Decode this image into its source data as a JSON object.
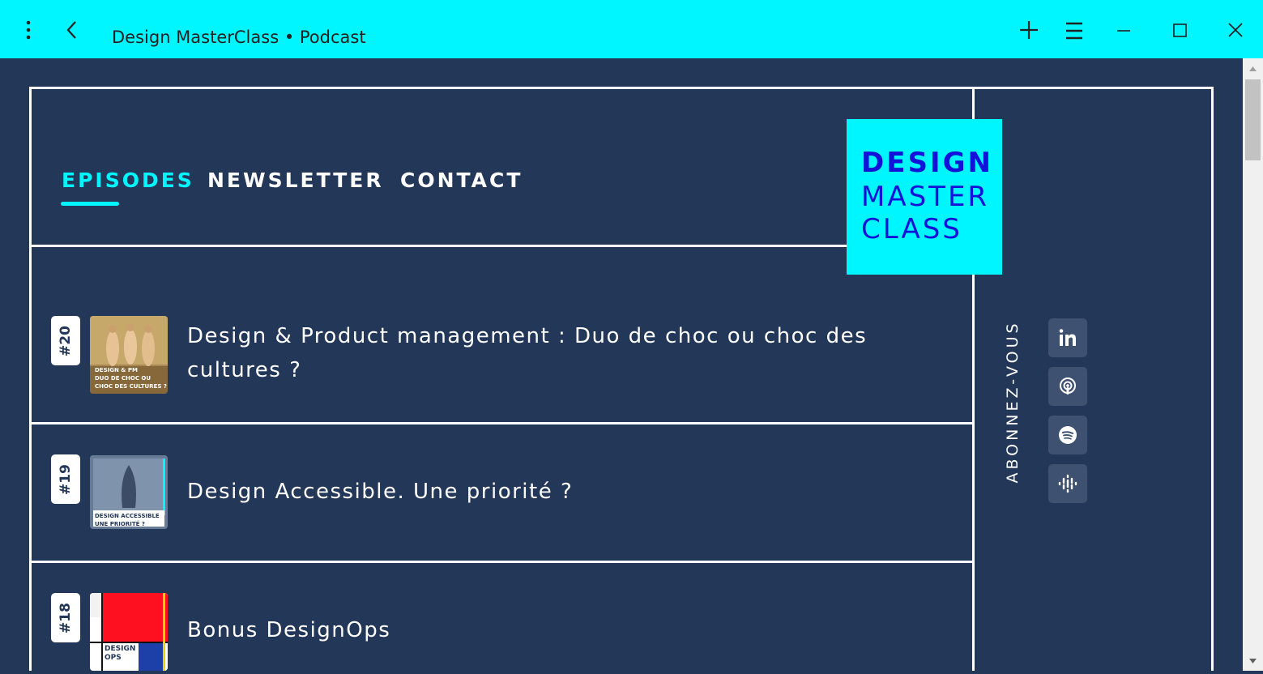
{
  "window": {
    "title": "Design MasterClass • Podcast"
  },
  "nav": {
    "items": [
      {
        "label": "EPISODES"
      },
      {
        "label": "NEWSLETTER"
      },
      {
        "label": "CONTACT"
      }
    ]
  },
  "logo": {
    "line1": "DESIGN",
    "line2": "MASTER",
    "line3": "CLASS"
  },
  "episodes": [
    {
      "number": "#20",
      "title": "Design & Product management : Duo de choc ou choc des cultures ?",
      "thumb_text": [
        "DESIGN & PM",
        "DUO DE CHOC OU",
        "CHOC DES CULTURES ?"
      ]
    },
    {
      "number": "#19",
      "title": "Design Accessible. Une priorité ?",
      "thumb_text": [
        "DESIGN ACCESSIBLE",
        "UNE PRIORITÉ ?"
      ]
    },
    {
      "number": "#18",
      "title": "Bonus DesignOps",
      "thumb_text": [
        "DESIGN",
        "OPS"
      ]
    }
  ],
  "sidebar": {
    "subscribe_label": "ABONNEZ-VOUS",
    "socials": [
      {
        "icon": "linkedin-icon"
      },
      {
        "icon": "podcast-icon"
      },
      {
        "icon": "spotify-icon"
      },
      {
        "icon": "google-podcasts-icon"
      }
    ]
  },
  "colors": {
    "accent": "#00f6ff",
    "background": "#233759",
    "logo_text": "#1212d8"
  }
}
